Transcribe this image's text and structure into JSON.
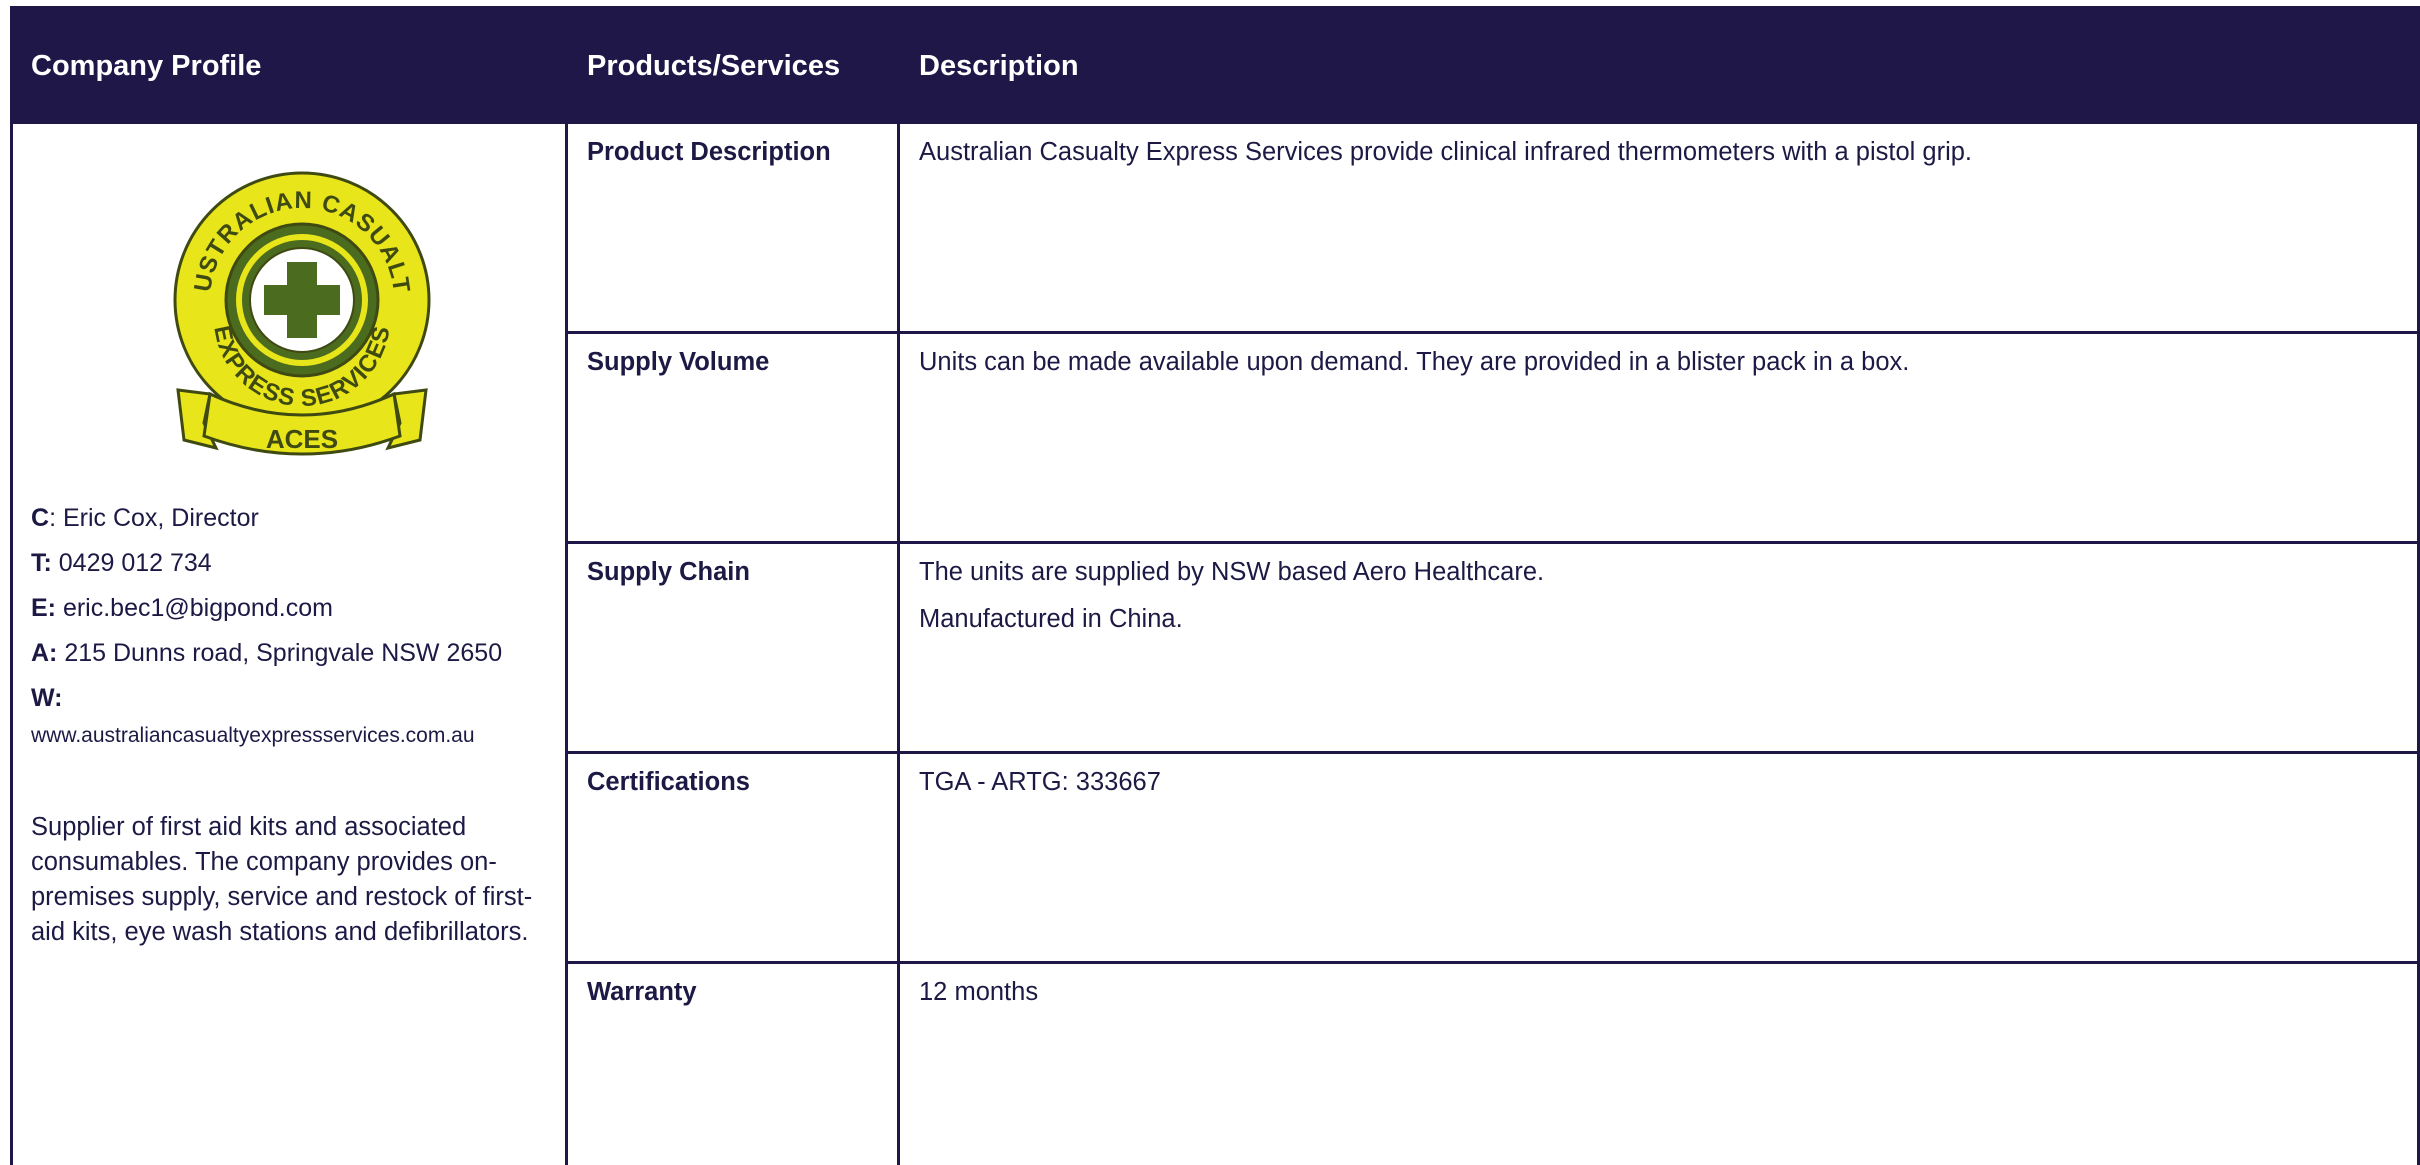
{
  "header": {
    "company_profile": "Company Profile",
    "products_services": "Products/Services",
    "description": "Description"
  },
  "logo": {
    "name": "aces-logo",
    "ring_text_top": "AUSTRALIAN CASUALTY",
    "ring_text_bottom": "EXPRESS SERVICES",
    "banner": "ACES",
    "colors": {
      "yellow": "#e8e51a",
      "green": "#4b6b1e",
      "outline": "#3f4a12"
    }
  },
  "contact": {
    "c_label": "C",
    "c_value": ": Eric Cox, Director",
    "t_label": "T:",
    "t_value": " 0429 012 734",
    "e_label": "E:",
    "e_value": " eric.bec1@bigpond.com",
    "a_label": "A:",
    "a_value": " 215 Dunns road, Springvale NSW 2650",
    "w_label": "W:",
    "w_value": "www.australiancasualtyexpressservices.com.au"
  },
  "about": "Supplier of first aid kits and associated consumables. The company provides on-premises supply, service and restock of first-aid kits, eye wash stations and defibrillators.",
  "rows": [
    {
      "label": "Product Description",
      "lines": [
        "Australian Casualty Express Services provide clinical infrared thermometers with a pistol grip."
      ]
    },
    {
      "label": "Supply Volume",
      "lines": [
        "Units can be made available upon demand. They are provided in a blister pack in a box."
      ]
    },
    {
      "label": "Supply Chain",
      "lines": [
        "The units are supplied by NSW based Aero Healthcare.",
        "Manufactured in China."
      ]
    },
    {
      "label": "Certifications",
      "lines": [
        "TGA - ARTG: 333667"
      ]
    },
    {
      "label": "Warranty",
      "lines": [
        "12 months"
      ]
    }
  ],
  "colors": {
    "navy": "#1f1748",
    "text": "#1c1a45"
  }
}
